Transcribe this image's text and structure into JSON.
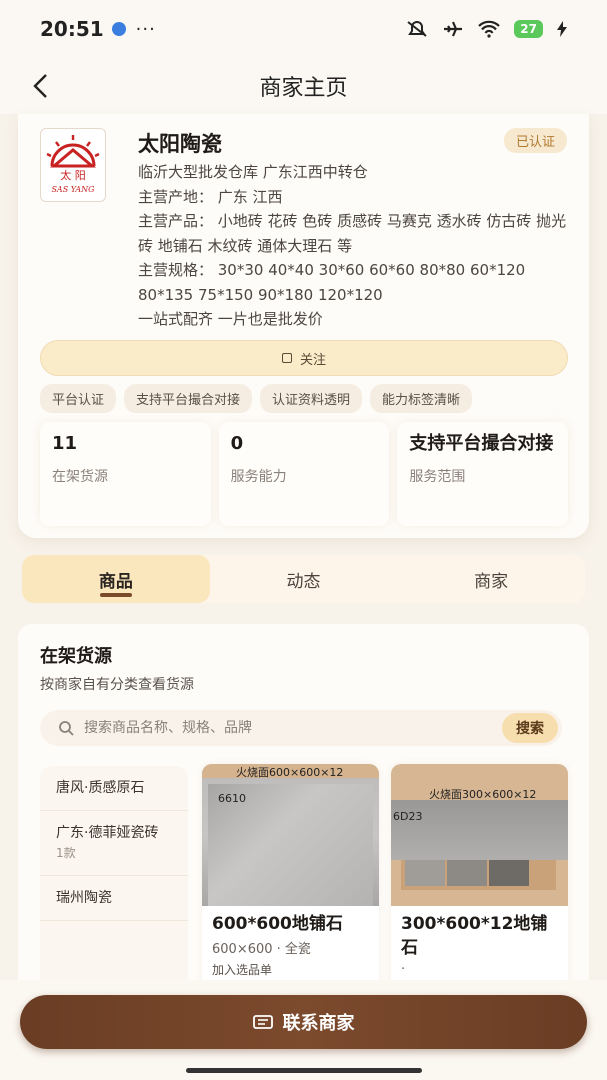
{
  "status_bar": {
    "time": "20:51",
    "more": "···",
    "battery": "27"
  },
  "nav": {
    "title": "商家主页"
  },
  "merchant": {
    "logo_text_top": "太  阳",
    "logo_text_bottom": "SAS YANG",
    "name": "太阳陶瓷",
    "badge": "已认证",
    "info_lines": [
      "临沂大型批发仓库 广东江西中转仓",
      "主营产地：  广东 江西",
      "主营产品：  小地砖 花砖 色砖 质感砖 马赛克 透水砖 仿古砖 抛光砖 地铺石 木纹砖 通体大理石 等",
      "主营规格：  30*30 40*40 30*60 60*60 80*80 60*120 80*135 75*150 90*180 120*120",
      "一站式配齐 一片也是批发价"
    ],
    "follow_label": "关注",
    "tags": [
      "平台认证",
      "支持平台撮合对接",
      "认证资料透明",
      "能力标签清晰"
    ],
    "stats": [
      {
        "value": "11",
        "label": "在架货源"
      },
      {
        "value": "0",
        "label": "服务能力"
      },
      {
        "value": "支持平台撮合对接",
        "label": "服务范围"
      }
    ]
  },
  "tabs": [
    {
      "label": "商品",
      "active": true
    },
    {
      "label": "动态",
      "active": false
    },
    {
      "label": "商家",
      "active": false
    }
  ],
  "goods": {
    "title": "在架货源",
    "subtitle": "按商家自有分类查看货源",
    "search_placeholder": "搜索商品名称、规格、品牌",
    "search_button": "搜索",
    "categories": [
      {
        "name": "唐风·质感原石",
        "count": ""
      },
      {
        "name": "广东·德菲娅瓷砖",
        "count": "1款"
      },
      {
        "name": "瑞州陶瓷",
        "count": ""
      }
    ],
    "products": [
      {
        "img_caption_top": "火烧面600×600×12",
        "img_caption_code": "6610",
        "title": "600*600地铺石",
        "sub": "600×600 · 全瓷",
        "add": "加入选品单"
      },
      {
        "img_caption_top": "火烧面300×600×12",
        "img_caption_code": "6D23",
        "title": "300*600*12地铺石",
        "sub": "·",
        "add": ""
      }
    ]
  },
  "bottom": {
    "contact_label": "联系商家"
  },
  "colors": {
    "accent_brown": "#6a3d24",
    "badge_gold": "#b07a2f",
    "tab_active_bg": "#fbe7bd"
  }
}
